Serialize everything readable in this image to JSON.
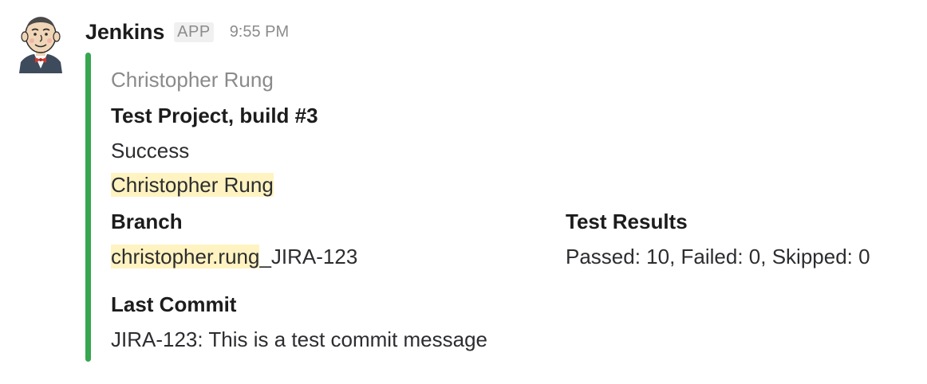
{
  "message": {
    "sender": "Jenkins",
    "badge": "APP",
    "timestamp": "9:55 PM",
    "avatar_icon": "jenkins-butler-avatar",
    "attachment": {
      "color": "#36a64f",
      "author": "Christopher Rung",
      "title": "Test Project, build #3",
      "text": "Success",
      "mention": "Christopher Rung",
      "fields": {
        "branch": {
          "title": "Branch",
          "value_highlight": "christopher.rung",
          "value_rest": "_JIRA-123"
        },
        "test_results": {
          "title": "Test Results",
          "value": "Passed: 10, Failed: 0, Skipped: 0"
        },
        "last_commit": {
          "title": "Last Commit",
          "value": "JIRA-123: This is a test commit message"
        }
      }
    }
  }
}
